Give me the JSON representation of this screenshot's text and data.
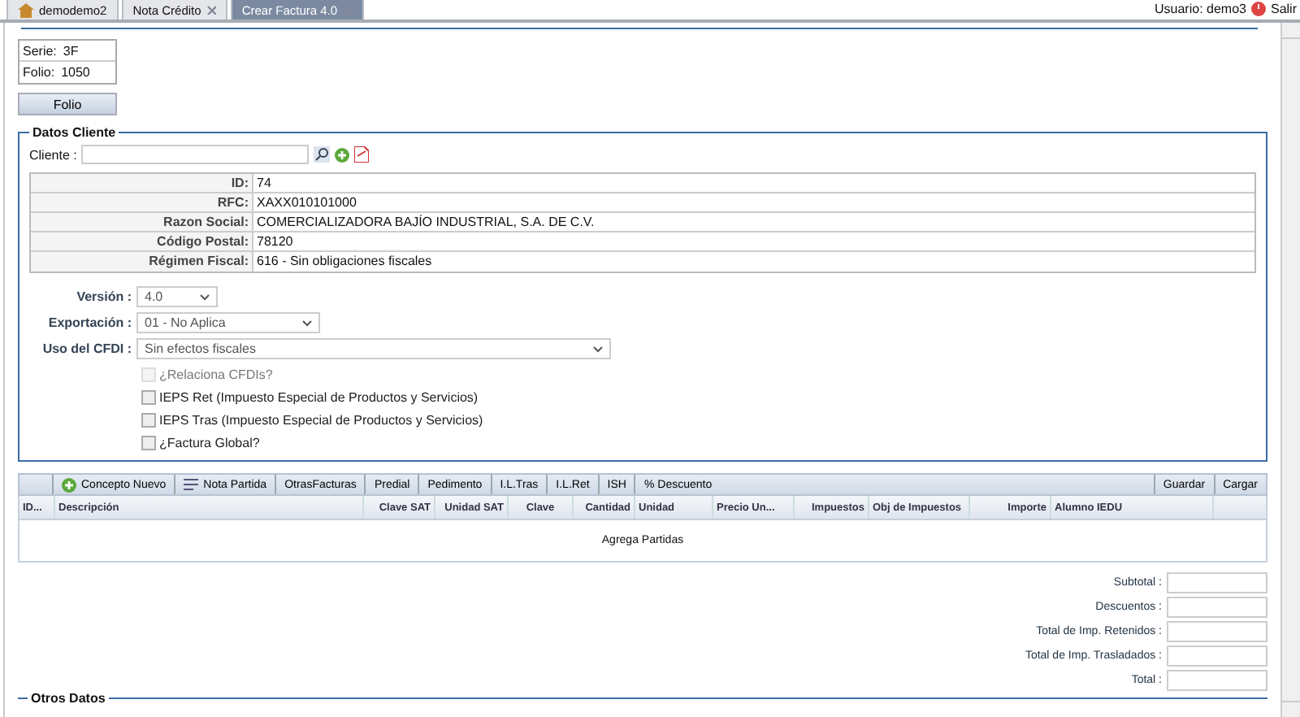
{
  "tabs": [
    {
      "label": "demodemo2",
      "kind": "home",
      "selected": false
    },
    {
      "label": "Nota Crédito",
      "kind": "closable",
      "selected": false
    },
    {
      "label": "Crear Factura 4.0",
      "kind": "closable",
      "selected": true
    }
  ],
  "user": {
    "label": "Usuario: demo3",
    "logout": "Salir"
  },
  "serie_folio": [
    {
      "label": "Serie:",
      "value": "3F"
    },
    {
      "label": "Folio:",
      "value": "1050"
    }
  ],
  "folio_button": "Folio",
  "datos_cliente": {
    "legend": "Datos Cliente",
    "cliente_label": "Cliente :",
    "info": [
      {
        "label": "ID:",
        "value": "74"
      },
      {
        "label": "RFC:",
        "value": "XAXX010101000"
      },
      {
        "label": "Razon Social:",
        "value": "COMERCIALIZADORA BAJÍO INDUSTRIAL, S.A. DE C.V."
      },
      {
        "label": "Código Postal:",
        "value": "78120"
      },
      {
        "label": "Régimen Fiscal:",
        "value": "616 - Sin obligaciones fiscales"
      }
    ]
  },
  "selects": [
    {
      "label": "Versión :",
      "value": "4.0"
    },
    {
      "label": "Exportación :",
      "value": "01 - No Aplica"
    },
    {
      "label": "Uso del CFDI :",
      "value": "Sin efectos fiscales"
    }
  ],
  "checkboxes": [
    {
      "label": "¿Relaciona CFDIs?",
      "checked": false,
      "disabled": true
    },
    {
      "label": "IEPS Ret (Impuesto Especial de Productos y Servicios)",
      "checked": false,
      "disabled": false
    },
    {
      "label": "IEPS Tras (Impuesto Especial de Productos y Servicios)",
      "checked": false,
      "disabled": false
    },
    {
      "label": "¿Factura Global?",
      "checked": false,
      "disabled": false
    }
  ],
  "toolbar": {
    "left": [
      {
        "label": "Concepto Nuevo",
        "kind": "add"
      },
      {
        "label": "Nota Partida",
        "kind": "note"
      },
      {
        "label": "OtrasFacturas",
        "kind": "text"
      },
      {
        "label": "Predial",
        "kind": "text"
      },
      {
        "label": "Pedimento",
        "kind": "text"
      },
      {
        "label": "I.L.Tras",
        "kind": "text"
      },
      {
        "label": "I.L.Ret",
        "kind": "text"
      },
      {
        "label": "ISH",
        "kind": "text"
      },
      {
        "label": "% Descuento",
        "kind": "text"
      }
    ],
    "right": [
      "Guardar",
      "Cargar"
    ]
  },
  "grid": {
    "columns": [
      "ID...",
      "Descripción",
      "Clave SAT",
      "Unidad SAT",
      "Clave",
      "Cantidad",
      "Unidad",
      "Precio Un...",
      "Impuestos",
      "Obj de Impuestos",
      "Importe",
      "Alumno IEDU"
    ],
    "empty": "Agrega Partidas"
  },
  "totals": [
    "Subtotal :",
    "Descuentos :",
    "Total de Imp. Retenidos :",
    "Total de Imp. Trasladados :",
    "Total :"
  ],
  "otros": "Otros Datos"
}
